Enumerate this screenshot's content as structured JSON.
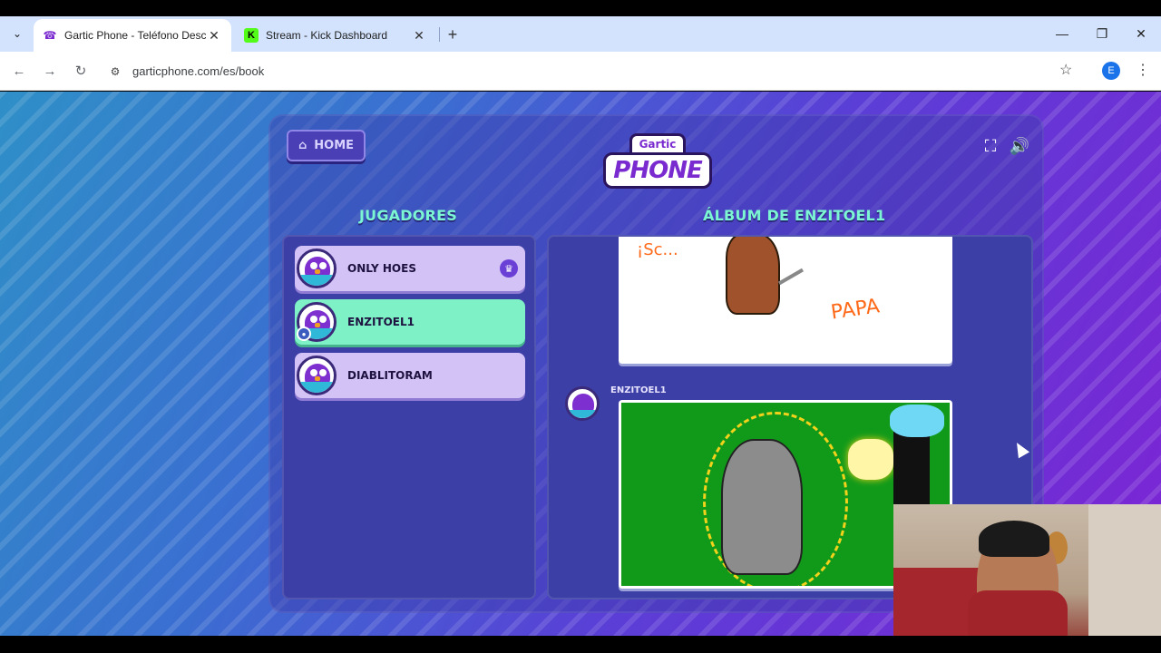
{
  "browser": {
    "tabs": [
      {
        "title": "Gartic Phone - Teléfono Descon",
        "favicon": "phone-icon",
        "active": true
      },
      {
        "title": "Stream - Kick Dashboard",
        "favicon": "kick-icon",
        "active": false
      }
    ],
    "url": "garticphone.com/es/book",
    "profile_initial": "E"
  },
  "game": {
    "home_label": "HOME",
    "logo_top": "Gartic",
    "logo_main": "PHONE",
    "players_heading": "JUGADORES",
    "album_heading": "ÁLBUM DE ENZITOEL1",
    "players": [
      {
        "name": "ONLY HOES",
        "host": true,
        "me": false
      },
      {
        "name": "ENZITOEL1",
        "host": false,
        "me": true
      },
      {
        "name": "DIABLITORAM",
        "host": false,
        "me": false
      }
    ],
    "album": {
      "entry_author": "ENZITOEL1",
      "drawing1_text_a": "¡Sc...",
      "drawing1_text_b": "PAPA"
    }
  },
  "colors": {
    "accent_heading": "#7cf6d2",
    "me_highlight": "#7ef2c6",
    "player_card": "#d3c2f5"
  }
}
